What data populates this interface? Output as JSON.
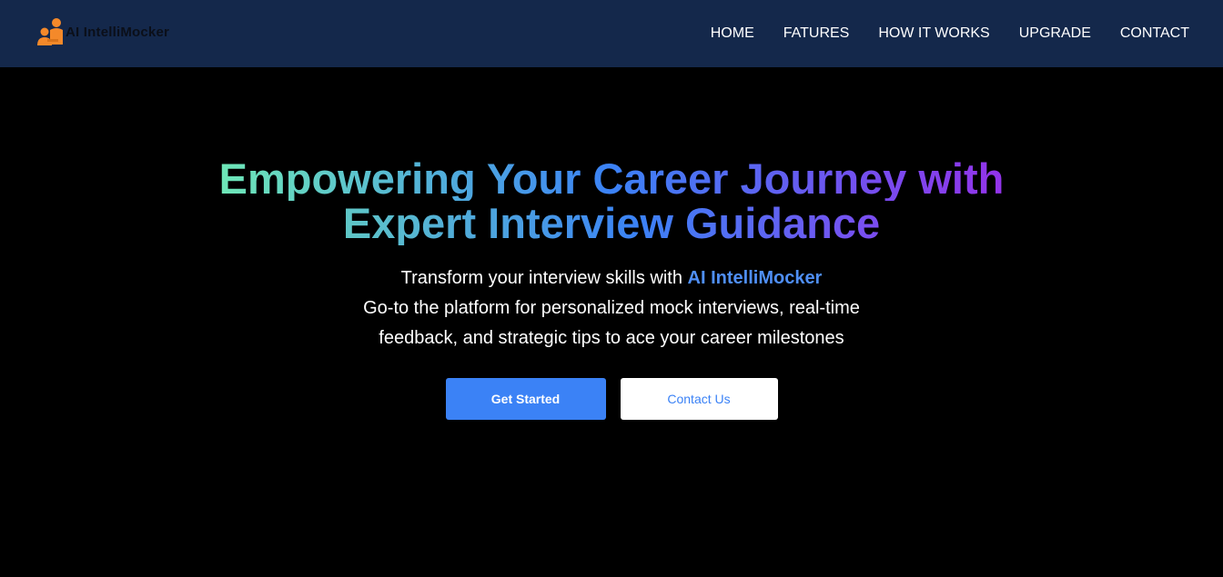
{
  "navbar": {
    "logo_text": "AI IntelliMocker",
    "logo_icon": "person-interview-icon",
    "links": [
      {
        "label": "HOME"
      },
      {
        "label": "FATURES"
      },
      {
        "label": "HOW IT WORKS"
      },
      {
        "label": "UPGRADE"
      },
      {
        "label": "CONTACT"
      }
    ]
  },
  "hero": {
    "title_line1": "Empowering Your Career Journey with",
    "title_line2": "Expert Interview Guidance",
    "subtitle_prefix": "Transform your interview skills with ",
    "subtitle_brand": "AI IntelliMocker",
    "description_line1": "Go-to the platform for personalized mock interviews, real-time",
    "description_line2": "feedback, and strategic tips to ace your career milestones",
    "primary_button": "Get Started",
    "secondary_button": "Contact Us"
  },
  "colors": {
    "navbar_bg": "#14284b",
    "page_bg": "#000000",
    "accent_blue": "#3b82f6",
    "logo_orange": "#f4892a",
    "gradient_start": "#6ee7b7",
    "gradient_end": "#9333ea"
  }
}
